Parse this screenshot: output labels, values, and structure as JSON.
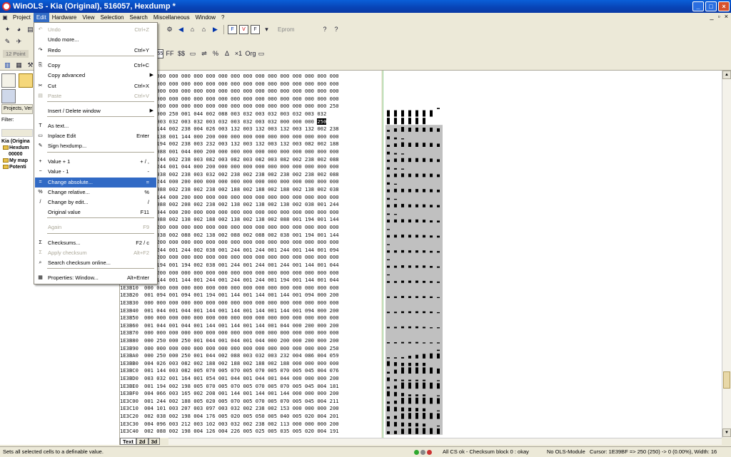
{
  "window": {
    "title": "WinOLS - Kia (Original), 516057, Hexdump *"
  },
  "menubar": {
    "items": [
      "Project",
      "Edit",
      "Hardware",
      "View",
      "Selection",
      "Search",
      "Miscellaneous",
      "Window",
      "?"
    ]
  },
  "toolbar": {
    "eprom_label": "Eprom",
    "point_label": "12 Point"
  },
  "left_panel": {
    "tab_label": "Projects, Ver",
    "filter_label": "Filter:",
    "tree": [
      "Kia (Origina",
      "Hexdum",
      "00000",
      "My map",
      "Potenti"
    ]
  },
  "edit_menu": {
    "items": [
      {
        "label": "Undo",
        "shortcut": "Ctrl+Z",
        "disabled": true,
        "icon": "undo-icon"
      },
      {
        "label": "Undo more...",
        "shortcut": "",
        "disabled": false,
        "icon": ""
      },
      {
        "label": "Redo",
        "shortcut": "Ctrl+Y",
        "disabled": false,
        "icon": "redo-icon"
      },
      {
        "label": "Copy",
        "shortcut": "Ctrl+C",
        "disabled": false,
        "icon": "copy-icon"
      },
      {
        "label": "Copy advanced",
        "shortcut": "",
        "disabled": false,
        "icon": "",
        "submenu": true
      },
      {
        "label": "Cut",
        "shortcut": "Ctrl+X",
        "disabled": false,
        "icon": "cut-icon"
      },
      {
        "label": "Paste",
        "shortcut": "Ctrl+V",
        "disabled": true,
        "icon": "paste-icon"
      },
      {
        "label": "Insert / Delete window",
        "shortcut": "",
        "disabled": false,
        "icon": "",
        "submenu": true
      },
      {
        "label": "As text...",
        "shortcut": "",
        "disabled": false,
        "icon": "text-icon"
      },
      {
        "label": "Inplace Edit",
        "shortcut": "Enter",
        "disabled": false,
        "icon": "edit-icon"
      },
      {
        "label": "Sign hexdump...",
        "shortcut": "",
        "disabled": false,
        "icon": "sign-icon"
      },
      {
        "label": "Value + 1",
        "shortcut": "+ / ,",
        "disabled": false,
        "icon": "value-plus-icon"
      },
      {
        "label": "Value - 1",
        "shortcut": "-",
        "disabled": false,
        "icon": "value-minus-icon"
      },
      {
        "label": "Change absolute...",
        "shortcut": "=",
        "disabled": false,
        "icon": "change-absolute-icon",
        "highlighted": true
      },
      {
        "label": "Change relative...",
        "shortcut": "%",
        "disabled": false,
        "icon": "change-relative-icon"
      },
      {
        "label": "Change by edit...",
        "shortcut": "/",
        "disabled": false,
        "icon": "change-edit-icon"
      },
      {
        "label": "Original value",
        "shortcut": "F11",
        "disabled": false,
        "icon": ""
      },
      {
        "label": "Again",
        "shortcut": "F9",
        "disabled": true,
        "icon": ""
      },
      {
        "label": "Checksums...",
        "shortcut": "F2 / c",
        "disabled": false,
        "icon": "checksum-icon"
      },
      {
        "label": "Apply checksum",
        "shortcut": "Alt+F2",
        "disabled": true,
        "icon": "apply-checksum-icon"
      },
      {
        "label": "Search checksum online...",
        "shortcut": "",
        "disabled": false,
        "icon": "search-online-icon"
      },
      {
        "label": "Properties: Window...",
        "shortcut": "Alt+Enter",
        "disabled": false,
        "icon": "properties-icon"
      }
    ]
  },
  "hexdump": {
    "rows": [
      {
        "addr": "",
        "cells": "000 000 000 000 000 000 000 000 000 000 000 000 000 000 000 000"
      },
      {
        "addr": "",
        "cells": "000 000 000 000 000 000 000 000 000 000 000 000 000 000 000 000"
      },
      {
        "addr": "",
        "cells": "000 000 000 000 000 000 000 000 000 000 000 000 000 000 000 000"
      },
      {
        "addr": "",
        "cells": "000 000 000 000 000 000 000 000 000 000 000 000 000 000 000 000"
      },
      {
        "addr": "",
        "cells": "000 000 000 000 000 000 000 000 000 000 000 000 000 000 000 250"
      },
      {
        "addr": "",
        "cells": "250 000 250 001 044 002 088 003 032 003 032 003 032 003 032"
      },
      {
        "addr": "",
        "cells": "032 003 032 003 032 003 032 003 032 003 032 000 000 000 250"
      },
      {
        "addr": "",
        "cells": "001 144 002 238 004 026 003 132 003 132 003 132 003 132 002 238"
      },
      {
        "addr": "",
        "cells": "002 138 001 144 000 200 000 000 000 000 000 000 000 000 000 000"
      },
      {
        "addr": "",
        "cells": "001 194 002 238 003 232 003 132 003 132 003 132 003 082 002 188"
      },
      {
        "addr": "",
        "cells": "002 088 001 044 000 200 000 000 000 000 000 000 000 000 000 000"
      },
      {
        "addr": "",
        "cells": "001 244 002 238 003 082 003 082 003 082 003 082 002 238 002 088"
      },
      {
        "addr": "",
        "cells": "001 244 001 044 000 200 000 000 000 000 000 000 000 000 000 000"
      },
      {
        "addr": "",
        "cells": "002 038 002 238 003 032 002 238 002 238 002 238 002 238 002 088"
      },
      {
        "addr": "",
        "cells": "001 244 000 200 000 000 000 000 000 000 000 000 000 000 000 000"
      },
      {
        "addr": "",
        "cells": "002 088 002 238 002 238 002 188 002 188 002 188 002 138 002 038"
      },
      {
        "addr": "",
        "cells": "001 144 000 200 000 000 000 000 000 000 000 000 000 000 000 000"
      },
      {
        "addr": "",
        "cells": "002 088 002 208 002 238 002 138 002 138 002 138 002 038 001 244"
      },
      {
        "addr": "",
        "cells": "001 044 000 200 000 000 000 000 000 000 000 000 000 000 000 000"
      },
      {
        "addr": "",
        "cells": "002 088 002 138 002 188 002 138 002 138 002 088 001 194 001 144"
      },
      {
        "addr": "",
        "cells": "000 200 000 000 000 000 000 000 000 000 000 000 000 000 000 000"
      },
      {
        "addr": "",
        "cells": "002 038 002 088 002 138 002 088 002 088 002 038 001 194 001 144"
      },
      {
        "addr": "",
        "cells": "000 200 000 000 000 000 000 000 000 000 000 000 000 000 000 000"
      },
      {
        "addr": "",
        "cells": "001 244 001 244 002 038 001 244 001 244 001 244 001 144 001 094"
      },
      {
        "addr": "",
        "cells": "000 200 000 000 000 000 000 000 000 000 000 000 000 000 000 000"
      },
      {
        "addr": "",
        "cells": "001 194 001 194 002 038 001 244 001 244 001 244 001 144 001 044"
      },
      {
        "addr": "",
        "cells": "000 200 000 000 000 000 000 000 000 000 000 000 000 000 000 000"
      },
      {
        "addr": "",
        "cells": "001 144 001 144 001 244 001 244 001 244 001 194 001 144 001 044"
      },
      {
        "addr": "1E3B10",
        "cells": "000 000 000 000 000 000 000 000 000 000 000 000 000 000 000 000"
      },
      {
        "addr": "1E3B20",
        "cells": "001 094 001 094 001 194 001 144 001 144 001 144 001 094 000 200"
      },
      {
        "addr": "1E3B30",
        "cells": "000 000 000 000 000 000 000 000 000 000 000 000 000 000 000 000"
      },
      {
        "addr": "1E3B40",
        "cells": "001 044 001 044 001 144 001 144 001 144 001 144 001 094 000 200"
      },
      {
        "addr": "1E3B50",
        "cells": "000 000 000 000 000 000 000 000 000 000 000 000 000 000 000 000"
      },
      {
        "addr": "1E3B60",
        "cells": "001 044 001 044 001 144 001 144 001 144 001 044 000 200 000 200"
      },
      {
        "addr": "1E3B70",
        "cells": "000 000 000 000 000 000 000 000 000 000 000 000 000 000 000 000"
      },
      {
        "addr": "1E3B80",
        "cells": "000 250 000 250 001 044 001 044 001 044 000 200 000 200 000 200"
      },
      {
        "addr": "1E3B90",
        "cells": "000 000 000 000 000 000 000 000 000 000 000 000 000 000 000 250"
      },
      {
        "addr": "1E3BA0",
        "cells": "000 250 000 250 001 044 002 088 003 032 003 232 004 086 004 059"
      },
      {
        "addr": "1E3BB0",
        "cells": "004 026 003 082 002 188 002 188 002 188 002 188 000 000 000 000"
      },
      {
        "addr": "1E3BC0",
        "cells": "001 144 003 082 005 070 005 070 005 070 005 070 005 045 004 076"
      },
      {
        "addr": "1E3BD0",
        "cells": "003 032 001 164 001 054 001 044 001 044 001 044 000 000 000 200"
      },
      {
        "addr": "1E3BE0",
        "cells": "001 194 002 198 005 070 005 070 005 070 005 070 005 045 004 181"
      },
      {
        "addr": "1E3BF0",
        "cells": "004 066 003 165 002 208 001 144 001 144 001 144 000 000 000 200"
      },
      {
        "addr": "1E3C00",
        "cells": "001 244 002 188 005 020 005 070 005 070 005 070 005 045 004 211"
      },
      {
        "addr": "1E3C10",
        "cells": "004 101 003 207 003 097 003 032 002 238 002 153 000 000 000 200"
      },
      {
        "addr": "1E3C20",
        "cells": "002 038 002 198 004 176 005 020 005 050 005 040 005 020 004 201"
      },
      {
        "addr": "1E3C30",
        "cells": "004 096 003 212 003 102 003 032 002 238 002 113 000 000 000 200"
      },
      {
        "addr": "1E3C40",
        "cells": "002 088 002 198 004 126 004 226 005 025 005 035 005 020 004 191"
      }
    ]
  },
  "view_tabs": [
    "Text",
    "2d",
    "3d"
  ],
  "status": {
    "left": "Sets all selected cells to a definable value.",
    "cs": "All CS ok - Checksum block 0 : okay",
    "module": "No OLS-Module",
    "cursor": "Cursor: 1E39BF => 250 (250) -> 0 (0.00%), Width: 16"
  },
  "colors": {
    "title_blue": "#0a5fd8",
    "menu_highlight": "#316ac5",
    "graph_fill": "#c0c0c0"
  }
}
